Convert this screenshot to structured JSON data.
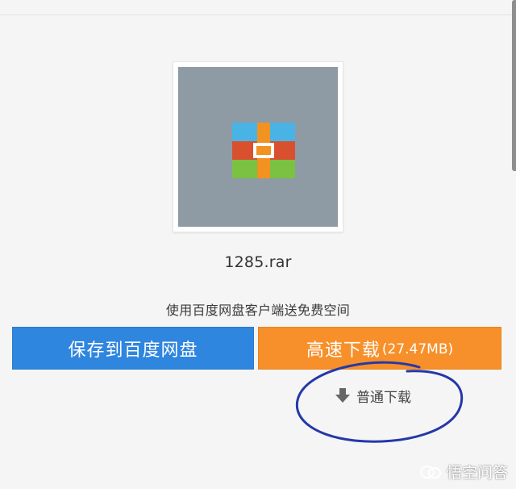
{
  "file": {
    "name": "1285.rar",
    "icon": "winrar-archive-icon"
  },
  "promo": {
    "text": "使用百度网盘客户端送免费空间"
  },
  "buttons": {
    "save_label": "保存到百度网盘",
    "fast_label": "高速下载",
    "fast_size": "(27.47MB)",
    "normal_label": "普通下载"
  },
  "annotation": {
    "shape": "hand-drawn ellipse around normal download",
    "color": "#2538a8"
  },
  "watermark": {
    "text": "悟空问答"
  },
  "colors": {
    "save_button": "#2f86df",
    "fast_button": "#f7902a",
    "thumbnail_bg": "#8e9ba5"
  }
}
